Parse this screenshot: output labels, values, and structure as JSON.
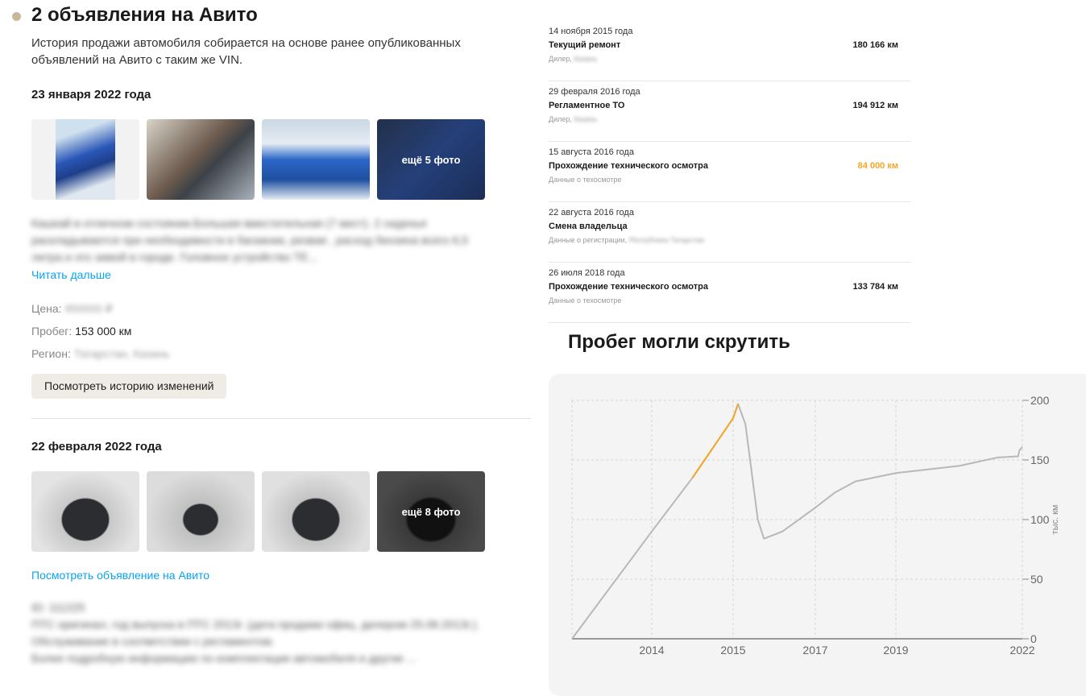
{
  "header": {
    "title": "2 объявления на Авито",
    "intro": "История продажи автомобиля собирается на основе ранее опубликованных объявлений на Авито с таким же VIN."
  },
  "listings": [
    {
      "date": "23 января 2022 года",
      "more_photos": "ещё 5 фото",
      "description": "Кашкай в отличном состоянии.Большая вместительная (7 мест). 2 сиденья раскладываются при необходимости в багажник, резвая , расход бензина всего 6,5 литра и это зимой в городе. Головное устройство ТЕ...",
      "read_more": "Читать дальше",
      "price_label": "Цена:",
      "price_value": "950000 ₽",
      "mileage_label": "Пробег:",
      "mileage_value": "153 000 км",
      "region_label": "Регион:",
      "region_value": "Татарстан, Казань",
      "history_button": "Посмотреть историю изменений"
    },
    {
      "date": "22 февраля 2022 года",
      "more_photos": "ещё 8 фото",
      "view_link": "Посмотреть объявление на Авито",
      "description": "ID: 111225\nПТС оригинал, год выпуска в ПТС 2013г. (дата продажи офиц. дилером 25.08.2013г.).\nОбслуживание в соответствии с регламентом.\nБолее подробную информацию по комплектации автомобиля и другие ..."
    }
  ],
  "events": [
    {
      "date": "14 ноября 2015 года",
      "title": "Текущий ремонт",
      "source": "Дилер,",
      "source_hidden": "Казань",
      "km": "180 166 км",
      "warn": false
    },
    {
      "date": "29 февраля 2016 года",
      "title": "Регламентное ТО",
      "source": "Дилер,",
      "source_hidden": "Казань",
      "km": "194 912 км",
      "warn": false
    },
    {
      "date": "15 августа 2016 года",
      "title": "Прохождение технического осмотра",
      "source": "Данные о техосмотре",
      "source_hidden": "",
      "km": "84 000 км",
      "warn": true
    },
    {
      "date": "22 августа 2016 года",
      "title": "Смена владельца",
      "source": "Данные о регистрации,",
      "source_hidden": "Республика Татарстан",
      "km": "",
      "warn": false
    },
    {
      "date": "26 июля 2018 года",
      "title": "Прохождение технического осмотра",
      "source": "Данные о техосмотре",
      "source_hidden": "",
      "km": "133 784 км",
      "warn": false
    }
  ],
  "chart_title": "Пробег могли скрутить",
  "colors": {
    "accent": "#f5a623",
    "line": "#b8b8b8",
    "link": "#0aa3f0"
  },
  "chart_data": {
    "type": "line",
    "ylabel": "тыс. км",
    "ylim": [
      0,
      200
    ],
    "yticks": [
      0,
      50,
      100,
      150,
      200
    ],
    "xticks": [
      "2014",
      "2015",
      "2017",
      "2019",
      "2022"
    ],
    "grid": true,
    "series": [
      {
        "name": "mileage",
        "x": [
          2013.0,
          2014.0,
          2014.5,
          2015.0,
          2015.12,
          2015.3,
          2015.6,
          2015.75,
          2016.2,
          2017.0,
          2017.5,
          2018.0,
          2019.0,
          2020.5,
          2021.4,
          2021.9,
          2021.93,
          2022.0
        ],
        "y": [
          0,
          90,
          135,
          185,
          197,
          180,
          100,
          84,
          90,
          110,
          123,
          132,
          139,
          145,
          152,
          153,
          158,
          161
        ]
      }
    ],
    "highlight": {
      "from": 2014.5,
      "to": 2015.2,
      "color": "#f5a623"
    }
  }
}
